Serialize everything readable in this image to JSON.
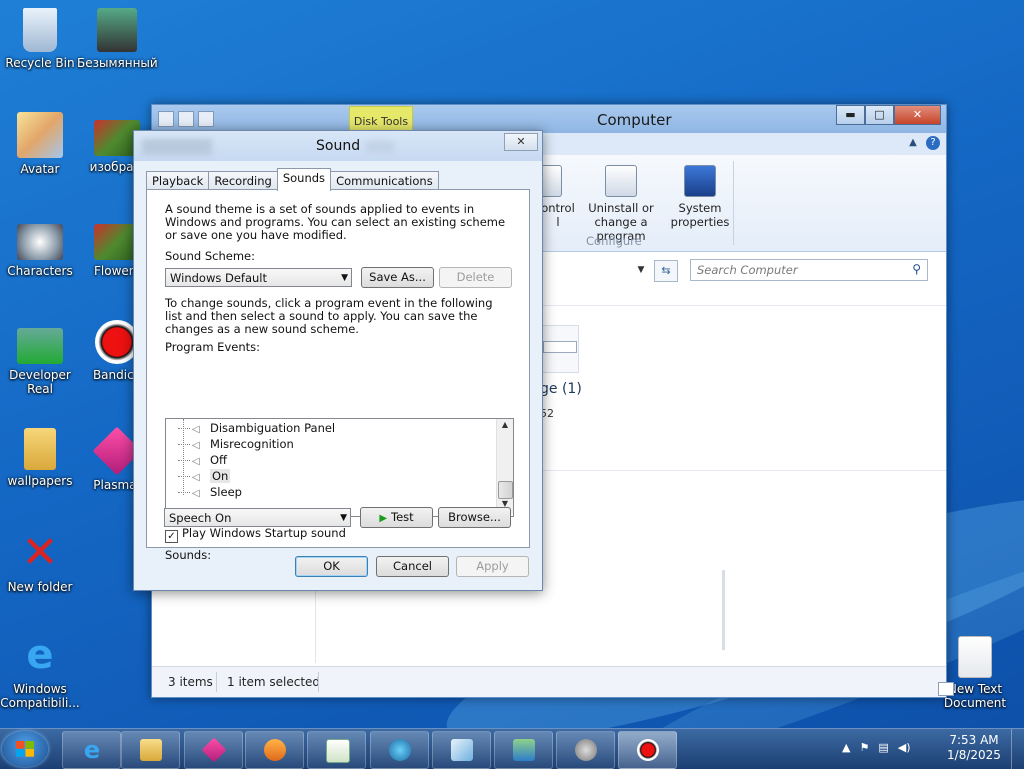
{
  "colors": {
    "accent": "#1467c4",
    "disk_tools": "#e6e86a",
    "dialog_bg": "#e8f0fa",
    "taskbar": "#1c3f72"
  },
  "desktop": {
    "icons": [
      {
        "label": "Recycle Bin",
        "icon": "recycle-bin-icon"
      },
      {
        "label": "Безымянный",
        "icon": "photo-icon"
      },
      {
        "label": "Avatar",
        "icon": "anime-image-icon"
      },
      {
        "label": "изображ",
        "icon": "image-icon"
      },
      {
        "label": "Characters",
        "icon": "characters-icon"
      },
      {
        "label": "Flowers",
        "icon": "flowers-icon"
      },
      {
        "label": "Developer Real",
        "icon": "photo-icon"
      },
      {
        "label": "Bandica",
        "icon": "bandicam-icon"
      },
      {
        "label": "wallpapers",
        "icon": "folder-zip-icon"
      },
      {
        "label": "Plasmaf",
        "icon": "plasma-icon"
      },
      {
        "label": "New folder",
        "icon": "red-x-icon"
      },
      {
        "label": "Windows Compatibili...",
        "icon": "ie-icon"
      },
      {
        "label": "New Text Document",
        "icon": "text-document-icon"
      }
    ]
  },
  "explorer": {
    "title": "Computer",
    "contextual_tab": "Disk Tools",
    "ribbon": {
      "control_fragment": "ontrol",
      "control_fragment2": "l",
      "uninstall": "Uninstall or change a program",
      "system_properties": "System properties",
      "group_label": "Configure"
    },
    "search_placeholder": "Search Computer",
    "group_fragment": "ge (1)",
    "number_fragment": "52",
    "status_items": "3 items",
    "status_selected": "1 item selected",
    "buttons": {
      "minimize": "▬",
      "maximize": "□",
      "close": "✕"
    }
  },
  "dialog": {
    "title": "Sound",
    "close": "✕",
    "tabs": [
      "Playback",
      "Recording",
      "Sounds",
      "Communications"
    ],
    "active_tab": "Sounds",
    "description": "A sound theme is a set of sounds applied to events in Windows and programs.  You can select an existing scheme or save one you have modified.",
    "scheme_label": "Sound Scheme:",
    "scheme_value": "Windows Default",
    "save_as": "Save As...",
    "delete": "Delete",
    "instructions": "To change sounds, click a program event in the following list and then select a sound to apply.  You can save the changes as a new sound scheme.",
    "events_label": "Program Events:",
    "events": [
      {
        "label": "Disambiguation Panel",
        "selected": false
      },
      {
        "label": "Misrecognition",
        "selected": false
      },
      {
        "label": "Off",
        "selected": false
      },
      {
        "label": "On",
        "selected": true
      },
      {
        "label": "Sleep",
        "selected": false
      }
    ],
    "startup_checkbox": "Play Windows Startup sound",
    "startup_checked": true,
    "sounds_label": "Sounds:",
    "sound_value": "Speech On",
    "test": "Test",
    "browse": "Browse...",
    "ok": "OK",
    "cancel": "Cancel",
    "apply": "Apply"
  },
  "taskbar": {
    "time": "7:53 AM",
    "date": "1/8/2025",
    "apps": [
      "ie-icon",
      "explorer-icon",
      "plasma-icon",
      "media-player-icon",
      "notepad-icon",
      "browser-icon",
      "file-icon",
      "control-panel-icon",
      "sound-icon",
      "bandicam-icon"
    ],
    "tray": [
      "show-hidden-icons-icon",
      "flag-icon",
      "network-icon",
      "volume-icon"
    ]
  }
}
